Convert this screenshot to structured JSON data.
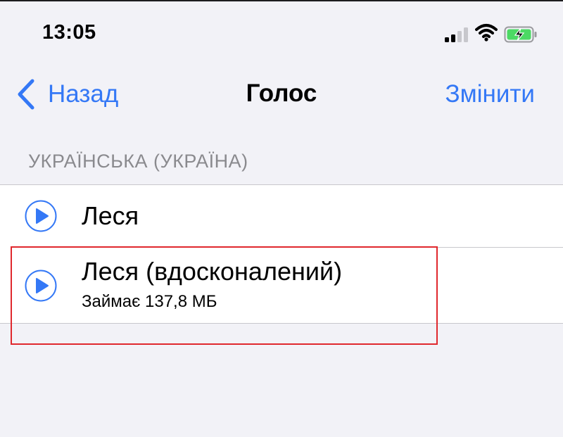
{
  "status_bar": {
    "time": "13:05",
    "icons": [
      "cellular-signal-icon",
      "wifi-icon",
      "battery-charging-icon"
    ],
    "battery_color": "#4cd964"
  },
  "nav": {
    "back_label": "Назад",
    "title": "Голос",
    "edit_label": "Змінити"
  },
  "section": {
    "header": "УКРАЇНСЬКА (УКРАЇНА)",
    "voices": [
      {
        "name": "Леся",
        "icon": "play-icon"
      },
      {
        "name": "Леся (вдосконалений)",
        "size": "Займає 137,8 МБ",
        "icon": "play-icon",
        "highlighted": true
      }
    ]
  },
  "colors": {
    "accent": "#3478f6",
    "background": "#f2f2f7",
    "highlight_border": "#e0282d",
    "secondary_text": "#8a8a8e"
  }
}
